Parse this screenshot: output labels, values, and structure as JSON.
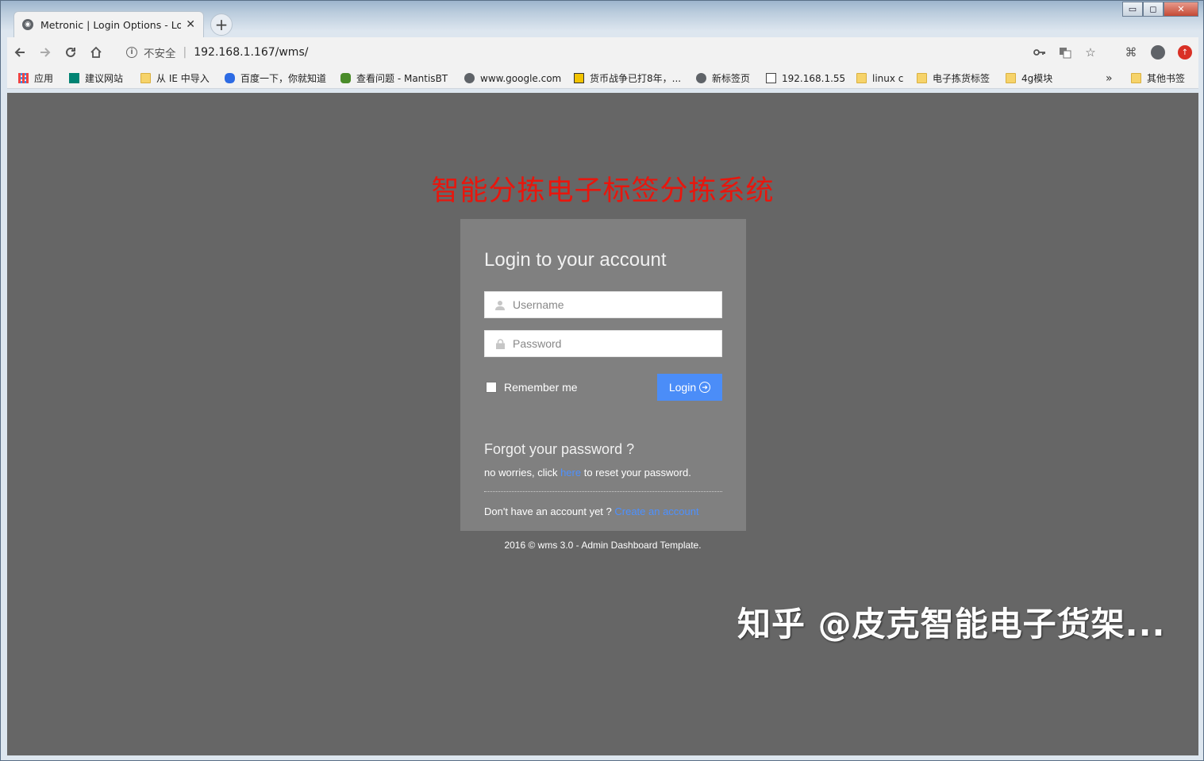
{
  "browser": {
    "tab_title": "Metronic | Login Options - Lo",
    "tab_close": "✕",
    "new_tab": "+",
    "window_controls": {
      "minimize": "▭",
      "restore": "◻",
      "close": "✕"
    },
    "security_label": "不安全",
    "url": "192.168.1.167/wms/",
    "bookmarks": [
      {
        "label": "应用",
        "icon": "apps-icon"
      },
      {
        "label": "建议网站",
        "icon": "bing-icon"
      },
      {
        "label": "从 IE 中导入",
        "icon": "folder-icon"
      },
      {
        "label": "百度一下，你就知道",
        "icon": "baidu-icon"
      },
      {
        "label": "查看问题 - MantisBT",
        "icon": "mantis-icon"
      },
      {
        "label": "www.google.com",
        "icon": "globe-icon"
      },
      {
        "label": "货币战争已打8年，...",
        "icon": "site-icon"
      },
      {
        "label": "新标签页",
        "icon": "globe-icon"
      },
      {
        "label": "192.168.1.55",
        "icon": "image-icon"
      },
      {
        "label": "linux c",
        "icon": "folder-icon"
      },
      {
        "label": "电子拣货标签",
        "icon": "folder-icon"
      },
      {
        "label": "4g模块",
        "icon": "folder-icon"
      }
    ],
    "more_bookmarks": "»",
    "other_bookmarks": "其他书签"
  },
  "page": {
    "system_title": "智能分拣电子标签分拣系统",
    "login": {
      "heading": "Login to your account",
      "username_placeholder": "Username",
      "password_placeholder": "Password",
      "remember_label": "Remember me",
      "login_button": "Login"
    },
    "forgot": {
      "heading": "Forgot your password ?",
      "text_before": "no worries, click ",
      "link": "here",
      "text_after": " to reset your password."
    },
    "signup": {
      "text": "Don't have an account yet ? ",
      "link": "Create an account"
    },
    "copyright": "2016 © wms 3.0 - Admin Dashboard Template."
  },
  "watermark": "知乎 @皮克智能电子货架...",
  "colors": {
    "page_bg": "#666666",
    "card_bg": "#808080",
    "title_red": "#e8160d",
    "button_blue": "#4b8df8",
    "link_blue": "#4d90fe"
  }
}
